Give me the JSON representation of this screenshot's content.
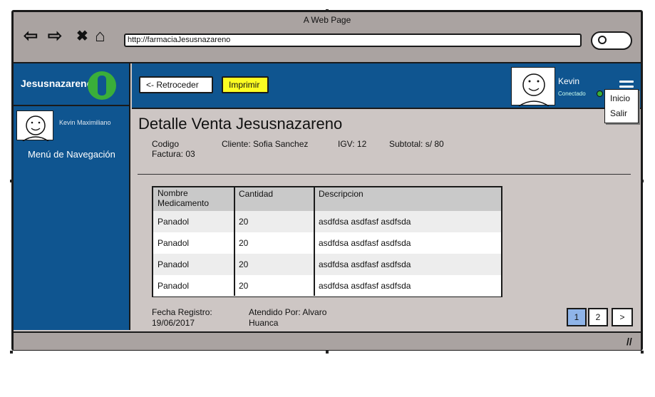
{
  "window": {
    "title": "A Web Page",
    "url": "http://farmaciaJesusnazareno"
  },
  "nav": {
    "back_glyph": "⇦",
    "forward_glyph": "⇨",
    "stop_glyph": "✖",
    "home_glyph": "⌂"
  },
  "sidebar": {
    "brand": "Jesusnazareno",
    "user_name": "Kevin Maximiliano",
    "nav_title": "Menú de Navegación"
  },
  "header": {
    "back_label": "<- Retroceder",
    "print_label": "Imprimir",
    "user": "Kevin",
    "status": "Conectado"
  },
  "dropdown": {
    "items": [
      "Inicio",
      "Salir"
    ]
  },
  "content": {
    "title": "Detalle Venta Jesusnazareno",
    "codigo": "Codigo Factura: 03",
    "cliente": "Cliente: Sofia Sanchez",
    "igv": "IGV: 12",
    "subtotal": "Subtotal: s/ 80"
  },
  "table": {
    "headers": [
      "Nombre Medicamento",
      "Cantidad",
      "Descripcion"
    ],
    "rows": [
      [
        "Panadol",
        "20",
        "asdfdsa asdfasf asdfsda"
      ],
      [
        "Panadol",
        "20",
        "asdfdsa asdfasf asdfsda"
      ],
      [
        "Panadol",
        "20",
        "asdfdsa asdfasf asdfsda"
      ],
      [
        "Panadol",
        "20",
        "asdfdsa asdfasf asdfsda"
      ]
    ]
  },
  "footer": {
    "fecha": "Fecha Registro: 19/06/2017",
    "atendido": "Atendido Por: Alvaro Huanca"
  },
  "pagination": {
    "pages": [
      "1",
      "2",
      ">"
    ],
    "active": "1"
  },
  "colors": {
    "brand_blue": "#0f5590",
    "print_yellow": "#fcfc22",
    "active_page": "#8fb4e8",
    "status_green": "#3aae3a"
  }
}
